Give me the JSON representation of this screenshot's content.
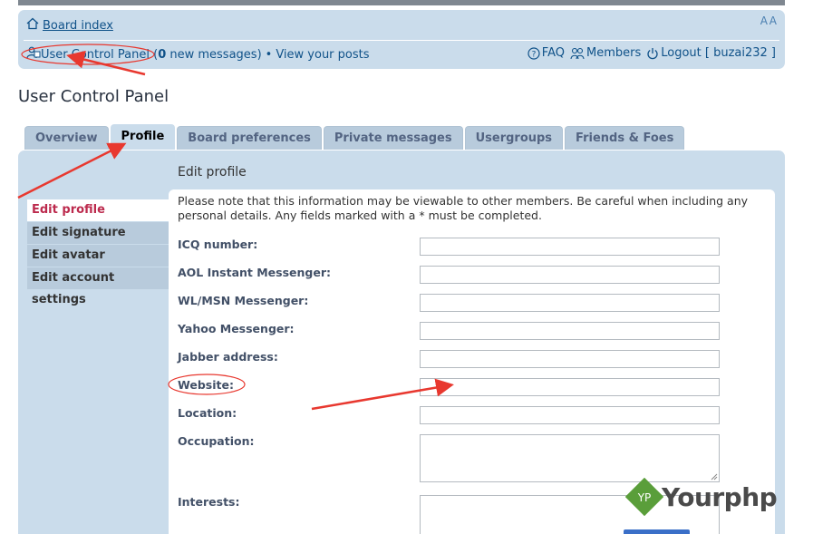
{
  "navbar": {
    "board_index": "Board index",
    "font_size_control": "A A",
    "ucp_link": "User Control Panel",
    "ucp_open": " (",
    "new_count": "0",
    "new_messages": " new messages)",
    "separator": "•",
    "view_posts": "View your posts",
    "faq": "FAQ",
    "members": "Members",
    "logout": "Logout [ buzai232 ]"
  },
  "page": {
    "title": "User Control Panel"
  },
  "tabs": [
    {
      "label": "Overview"
    },
    {
      "label": "Profile",
      "active": true
    },
    {
      "label": "Board preferences"
    },
    {
      "label": "Private messages"
    },
    {
      "label": "Usergroups"
    },
    {
      "label": "Friends & Foes"
    }
  ],
  "sidemenu": [
    {
      "label": "Edit profile",
      "active": true
    },
    {
      "label": "Edit signature"
    },
    {
      "label": "Edit avatar"
    },
    {
      "label": "Edit account settings"
    }
  ],
  "form": {
    "section_title": "Edit profile",
    "note": "Please note that this information may be viewable to other members. Be careful when including any personal details. Any fields marked with a * must be completed.",
    "fields": [
      {
        "label": "ICQ number:",
        "value": ""
      },
      {
        "label": "AOL Instant Messenger:",
        "value": ""
      },
      {
        "label": "WL/MSN Messenger:",
        "value": ""
      },
      {
        "label": "Yahoo Messenger:",
        "value": ""
      },
      {
        "label": "Jabber address:",
        "value": ""
      },
      {
        "label": "Website:",
        "value": ""
      },
      {
        "label": "Location:",
        "value": ""
      },
      {
        "label": "Occupation:",
        "value": ""
      },
      {
        "label": "Interests:",
        "value": ""
      }
    ]
  },
  "watermark": {
    "badge": "YP",
    "brand": "Yourphp"
  },
  "colors": {
    "panel": "#cadceb",
    "link": "#105289",
    "active_menu": "#bc2a4d",
    "annotation": "#e8382f"
  }
}
